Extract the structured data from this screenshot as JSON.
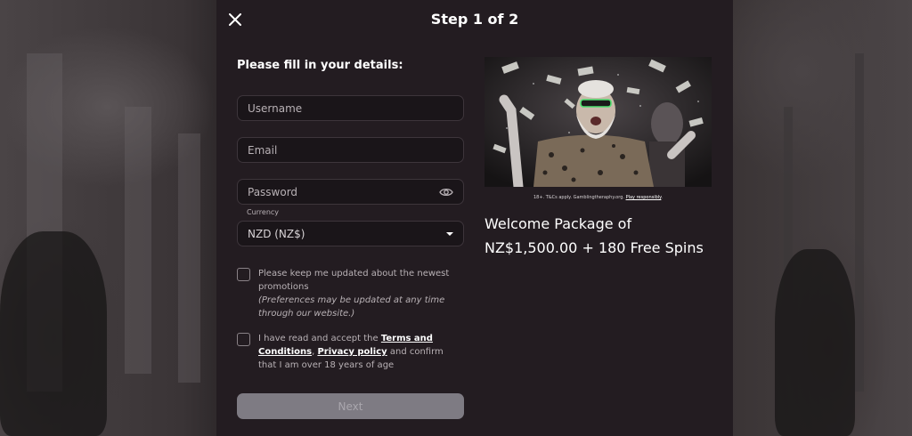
{
  "modal": {
    "title": "Step 1 of 2",
    "heading": "Please fill in your details:"
  },
  "form": {
    "username_placeholder": "Username",
    "email_placeholder": "Email",
    "password_placeholder": "Password",
    "currency_label": "Currency",
    "currency_value": "NZD (NZ$)",
    "promotions_text": "Please keep me updated about the newest promotions",
    "promotions_note": "(Preferences may be updated at any time through our website.)",
    "terms_prefix": "I have read and accept the ",
    "terms_link": "Terms and Conditions",
    "terms_comma": ",",
    "privacy_link": "Privacy policy",
    "terms_suffix": " and confirm that I am over 18 years of age",
    "next_label": "Next"
  },
  "promo": {
    "tcs_text": "18+. T&Cs apply. Gamblingtheraphy.org. ",
    "tcs_link": "Play responsibly",
    "tcs_end": ".",
    "welcome_line1": "Welcome Package of",
    "welcome_line2": "NZ$1,500.00 + 180 Free Spins"
  },
  "icons": {
    "close": "close-icon",
    "eye": "eye-icon",
    "caret": "chevron-down-icon"
  },
  "colors": {
    "modal_bg": "#231c21",
    "field_bg": "#1a1519",
    "button_disabled": "#7e7b83"
  }
}
